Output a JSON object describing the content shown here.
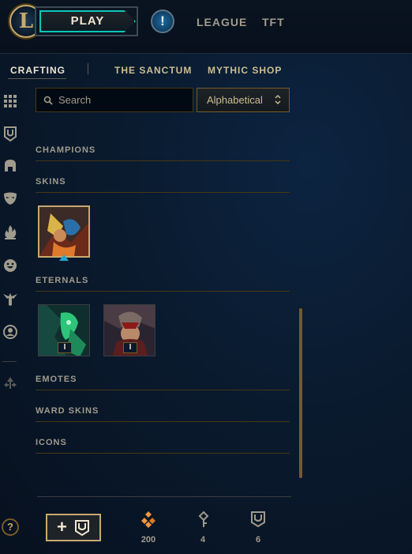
{
  "header": {
    "logo_letter": "L",
    "play_label": "PLAY",
    "alert_symbol": "!",
    "nav": [
      "LEAGUE",
      "TFT"
    ]
  },
  "subnav": {
    "tabs": [
      "CRAFTING",
      "THE SANCTUM",
      "MYTHIC SHOP"
    ],
    "active": "CRAFTING"
  },
  "sidebar": {
    "items": [
      "all-grid-icon",
      "chest-icon",
      "champion-helmet-icon",
      "skin-mask-icon",
      "fire-icon",
      "emote-face-icon",
      "ward-icon",
      "profile-icon",
      "arrows-icon"
    ]
  },
  "filters": {
    "search_placeholder": "Search",
    "sort_value": "Alphabetical"
  },
  "sections": {
    "champions": "CHAMPIONS",
    "skins": "SKINS",
    "eternals": "ETERNALS",
    "emotes": "EMOTES",
    "ward_skins": "WARD SKINS",
    "icons": "ICONS"
  },
  "eternals": [
    {
      "badge": "I"
    },
    {
      "badge": "I"
    }
  ],
  "footer": {
    "help_symbol": "?",
    "add_button": "+",
    "currencies": [
      {
        "icon": "orange-essence-icon",
        "value": "200"
      },
      {
        "icon": "key-fragment-icon",
        "value": "4"
      },
      {
        "icon": "chest-icon",
        "value": "6"
      }
    ]
  },
  "colors": {
    "gold": "#c8aa6e",
    "teal": "#0ac8b9",
    "background": "#0a1a2e",
    "orange_essence": "#f0963c"
  }
}
